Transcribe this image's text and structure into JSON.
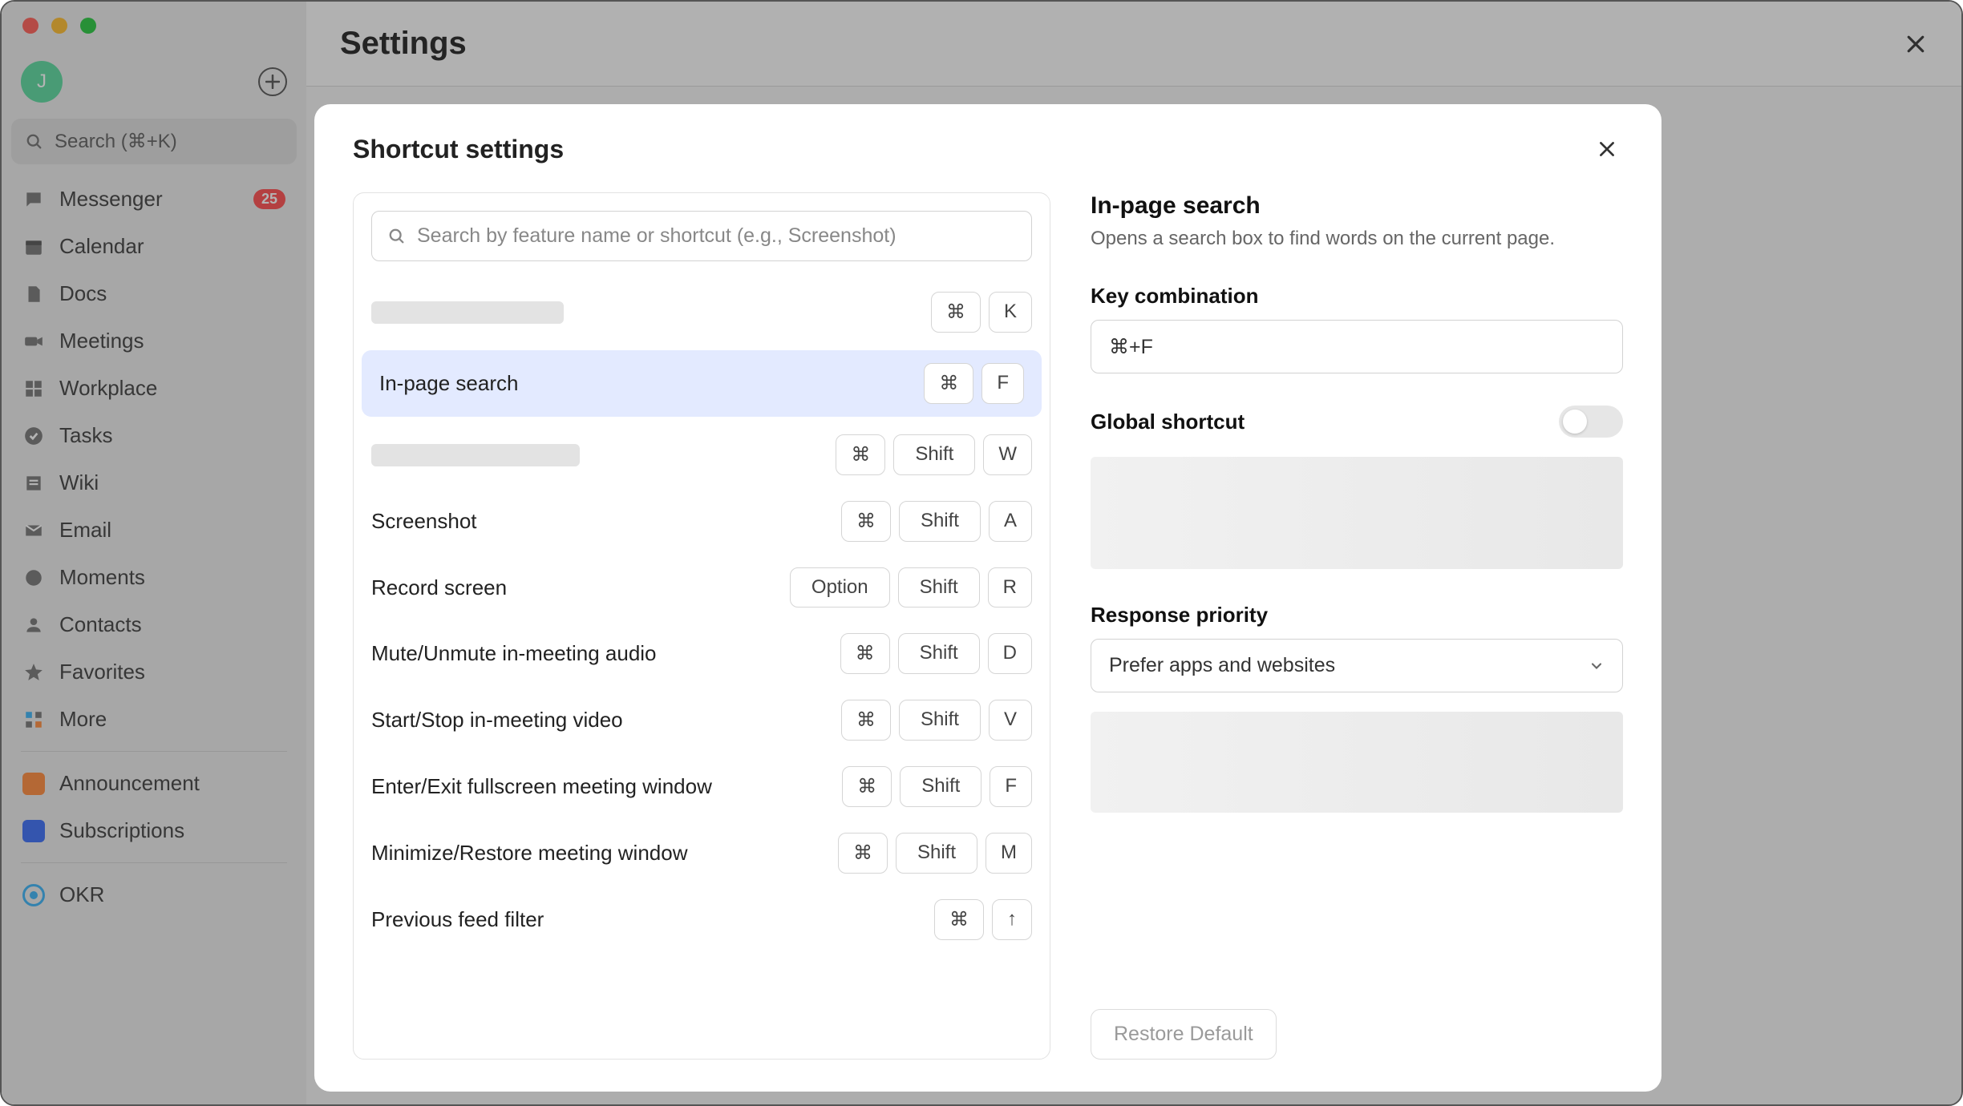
{
  "sidebar": {
    "avatar_initial": "J",
    "search_placeholder": "Search (⌘+K)",
    "items": [
      {
        "label": "Messenger",
        "badge": "25"
      },
      {
        "label": "Calendar"
      },
      {
        "label": "Docs"
      },
      {
        "label": "Meetings"
      },
      {
        "label": "Workplace"
      },
      {
        "label": "Tasks"
      },
      {
        "label": "Wiki"
      },
      {
        "label": "Email"
      },
      {
        "label": "Moments"
      },
      {
        "label": "Contacts"
      },
      {
        "label": "Favorites"
      },
      {
        "label": "More"
      }
    ],
    "extras": [
      {
        "label": "Announcement"
      },
      {
        "label": "Subscriptions"
      }
    ],
    "footer": {
      "label": "OKR"
    }
  },
  "header": {
    "title": "Settings"
  },
  "modal": {
    "title": "Shortcut settings",
    "search_placeholder": "Search by feature name or shortcut (e.g., Screenshot)",
    "rows": [
      {
        "label": "",
        "skeleton": true,
        "keys": [
          "⌘",
          "K"
        ]
      },
      {
        "label": "In-page search",
        "keys": [
          "⌘",
          "F"
        ],
        "selected": true
      },
      {
        "label": "",
        "skeleton": true,
        "keys": [
          "⌘",
          "Shift",
          "W"
        ]
      },
      {
        "label": "Screenshot",
        "keys": [
          "⌘",
          "Shift",
          "A"
        ]
      },
      {
        "label": "Record screen",
        "keys": [
          "Option",
          "Shift",
          "R"
        ]
      },
      {
        "label": "Mute/Unmute in-meeting audio",
        "keys": [
          "⌘",
          "Shift",
          "D"
        ]
      },
      {
        "label": "Start/Stop in-meeting video",
        "keys": [
          "⌘",
          "Shift",
          "V"
        ]
      },
      {
        "label": "Enter/Exit fullscreen meeting window",
        "keys": [
          "⌘",
          "Shift",
          "F"
        ]
      },
      {
        "label": "Minimize/Restore meeting window",
        "keys": [
          "⌘",
          "Shift",
          "M"
        ]
      },
      {
        "label": "Previous feed filter",
        "keys": [
          "⌘",
          "↑"
        ]
      }
    ],
    "detail": {
      "title": "In-page search",
      "description": "Opens a search box to find words on the current page.",
      "key_combination_label": "Key combination",
      "key_combination_value": "⌘+F",
      "global_shortcut_label": "Global shortcut",
      "global_shortcut_on": false,
      "response_priority_label": "Response priority",
      "response_priority_value": "Prefer apps and websites",
      "restore_label": "Restore Default"
    }
  }
}
